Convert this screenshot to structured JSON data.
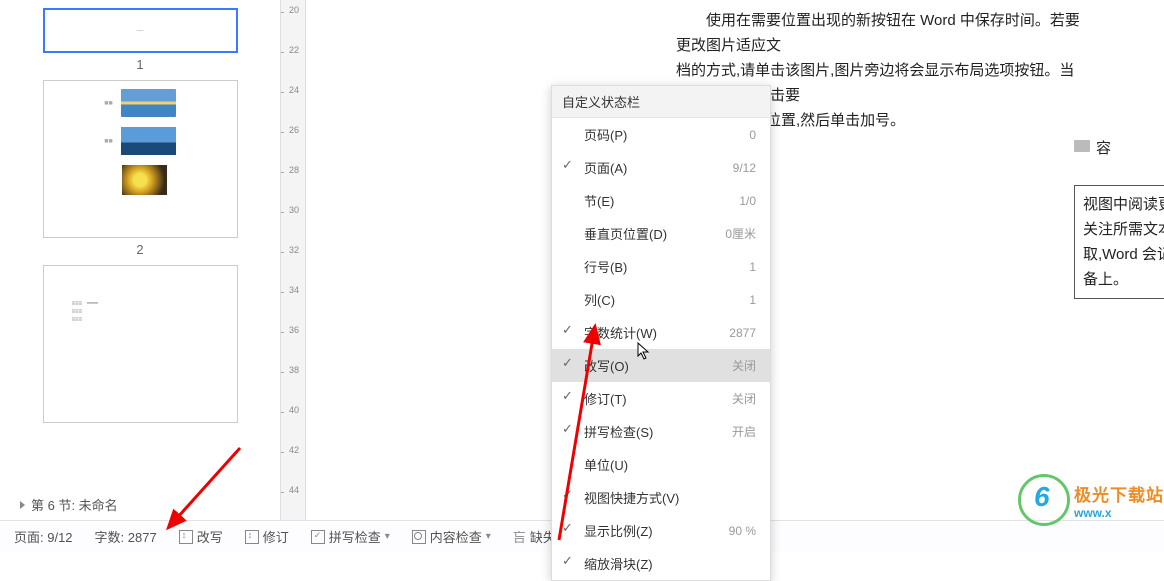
{
  "thumbnails": {
    "page1_num": "1",
    "page2_num": "2"
  },
  "section_nav": "第 6 节: 未命名",
  "ruler_ticks": [
    20,
    22,
    24,
    26,
    28,
    30,
    32,
    34,
    36,
    38,
    40,
    42,
    44
  ],
  "doc": {
    "line1": "使用在需要位置出现的新按钮在 Word 中保存时间。若要更改图片适应文",
    "line2": "档的方式,请单击该图片,图片旁边将会显示布局选项按钮。当处理表格时,单击要",
    "line3": "添加行或列的位置,然后单击加号。",
    "tiny_txt": "容",
    "box_line1": "视图中阅读更加容易。可以折叠文档",
    "box_line2": "关注所需文本。如果在达到结尾处之",
    "box_line3": "取,Word 会记住您的停止位置 - 即",
    "box_line4": "备上。"
  },
  "menu": {
    "header": "自定义状态栏",
    "items": [
      {
        "label": "页码(P)",
        "value": "0",
        "check": false
      },
      {
        "label": "页面(A)",
        "value": "9/12",
        "check": true
      },
      {
        "label": "节(E)",
        "value": "1/0",
        "check": false
      },
      {
        "label": "垂直页位置(D)",
        "value": "0厘米",
        "check": false
      },
      {
        "label": "行号(B)",
        "value": "1",
        "check": false
      },
      {
        "label": "列(C)",
        "value": "1",
        "check": false
      },
      {
        "label": "字数统计(W)",
        "value": "2877",
        "check": true
      },
      {
        "label": "改写(O)",
        "value": "关闭",
        "check": true,
        "highlight": true
      },
      {
        "label": "修订(T)",
        "value": "关闭",
        "check": true
      },
      {
        "label": "拼写检查(S)",
        "value": "开启",
        "check": true
      },
      {
        "label": "单位(U)",
        "value": "",
        "check": false
      },
      {
        "label": "视图快捷方式(V)",
        "value": "",
        "check": true
      },
      {
        "label": "显示比例(Z)",
        "value": "90 %",
        "check": true
      },
      {
        "label": "缩放滑块(Z)",
        "value": "",
        "check": true
      }
    ]
  },
  "statusbar": {
    "page": "页面: 9/12",
    "words": "字数: 2877",
    "overwrite": "改写",
    "revision": "修订",
    "spellcheck": "拼写检查",
    "contentcheck": "内容检查",
    "missingfont": "缺失字体"
  },
  "watermark": {
    "cn": "极光下载站",
    "en": "www.x"
  }
}
